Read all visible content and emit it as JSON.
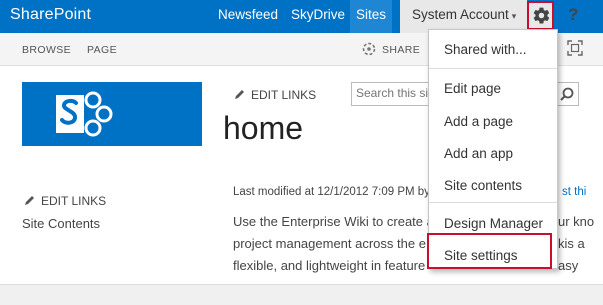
{
  "suitebar": {
    "brand": "SharePoint",
    "links": [
      "Newsfeed",
      "SkyDrive",
      "Sites"
    ],
    "account": "System Account",
    "account_caret": "▾",
    "help": "?"
  },
  "ribbon": {
    "tabs": [
      "BROWSE",
      "PAGE"
    ],
    "share": "SHARE"
  },
  "page": {
    "edit_links": "EDIT LINKS",
    "title": "home",
    "search_placeholder": "Search this sit",
    "left_edit_links": "EDIT LINKS",
    "quick_launch": [
      "Site Contents"
    ],
    "last_modified": "Last modified at 12/1/2012 7:09 PM by",
    "history_clip": "st thi",
    "content_lines": [
      "Use the Enterprise Wiki to create a",
      "project management across the e",
      "flexible, and lightweight in feature"
    ],
    "content_clips": [
      "ur kno",
      "kis a",
      "asy"
    ]
  },
  "settings_menu": {
    "items": [
      "Shared with...",
      "Edit page",
      "Add a page",
      "Add an app",
      "Site contents",
      "Design Manager",
      "Site settings"
    ]
  },
  "colors": {
    "suite_blue": "#0072c6",
    "highlight_red": "#c8102e"
  }
}
